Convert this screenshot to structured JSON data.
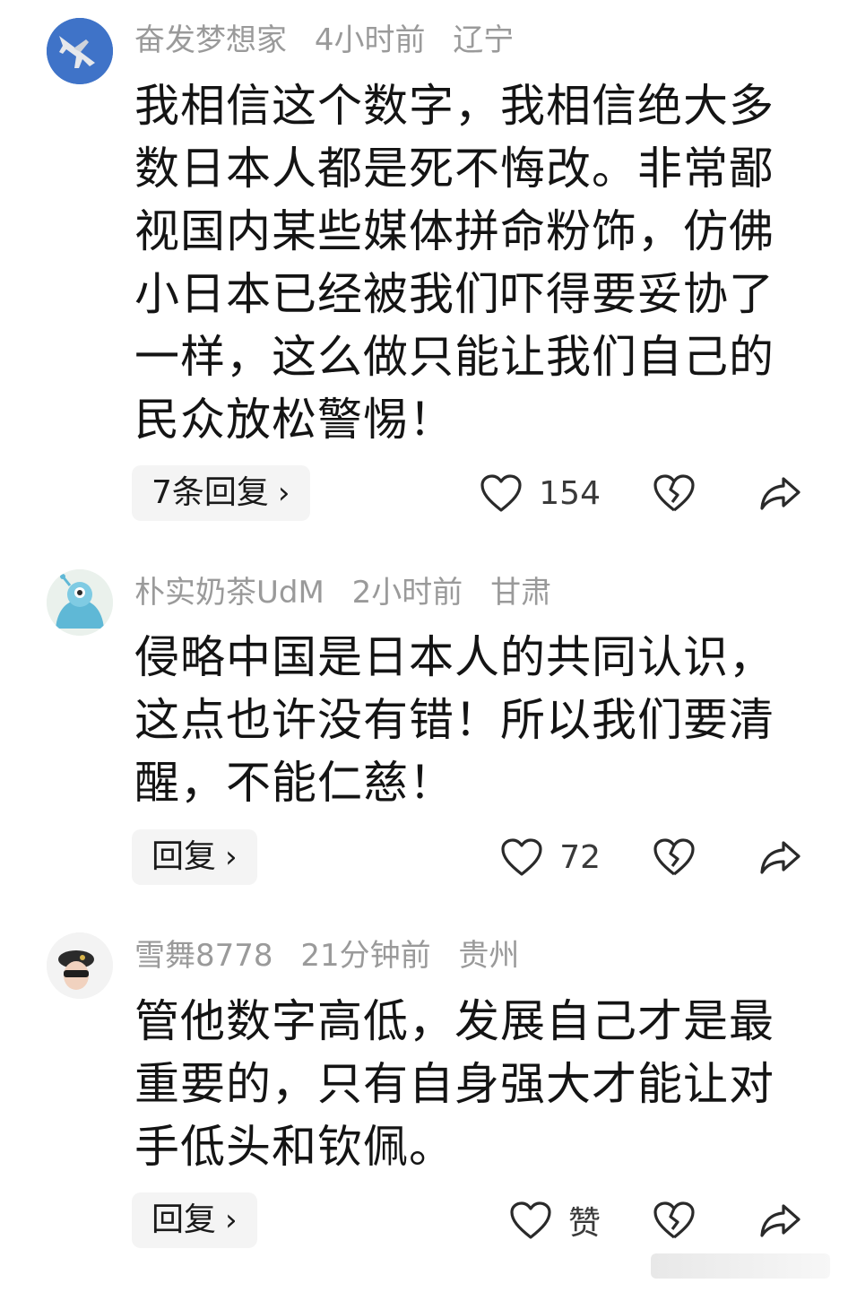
{
  "comments": [
    {
      "username": "奋发梦想家",
      "time": "4小时前",
      "location": "辽宁",
      "text": "我相信这个数字，我相信绝大多数日本人都是死不悔改。非常鄙视国内某些媒体拼命粉饰，仿佛小日本已经被我们吓得要妥协了一样，这么做只能让我们自己的民众放松警惕！",
      "reply_label": "7条回复",
      "like_count": "154",
      "avatar_icon": "jet-icon"
    },
    {
      "username": "朴实奶茶UdM",
      "time": "2小时前",
      "location": "甘肃",
      "text": "侵略中国是日本人的共同认识，这点也许没有错！所以我们要清醒，不能仁慈！",
      "reply_label": "回复",
      "like_count": "72",
      "avatar_icon": "alien-icon"
    },
    {
      "username": "雪舞8778",
      "time": "21分钟前",
      "location": "贵州",
      "text": "管他数字高低，发展自己才是最重要的，只有自身强大才能让对手低头和钦佩。",
      "reply_label": "回复",
      "like_count": "赞",
      "avatar_icon": "soldier-icon"
    }
  ],
  "colors": {
    "meta_text": "#9a9a9a",
    "reply_bg": "#f4f4f4",
    "body_text": "#141414"
  }
}
